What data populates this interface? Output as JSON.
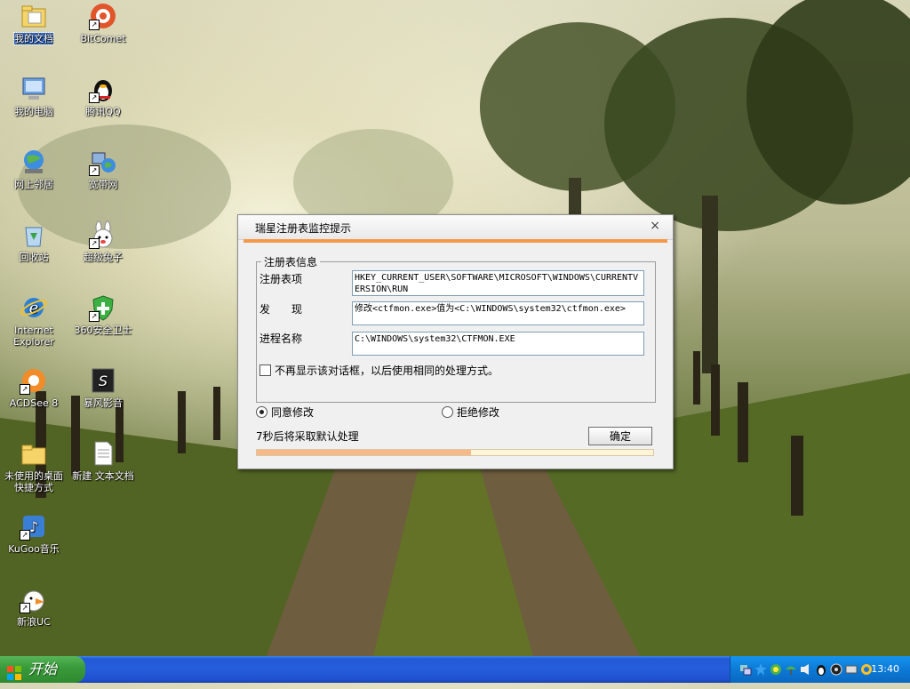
{
  "desktop": {
    "icons": [
      {
        "label": "我的文档"
      },
      {
        "label": "BitComet"
      },
      {
        "label": "我的电脑"
      },
      {
        "label": "腾讯QQ"
      },
      {
        "label": "网上邻居"
      },
      {
        "label": "宽带网"
      },
      {
        "label": "回收站"
      },
      {
        "label": "超级兔子"
      },
      {
        "label": "Internet Explorer"
      },
      {
        "label": "360安全卫士"
      },
      {
        "label": "ACDSee 8"
      },
      {
        "label": "暴风影音"
      },
      {
        "label": "未使用的桌面快捷方式"
      },
      {
        "label": "新建 文本文档"
      },
      {
        "label": "KuGoo音乐"
      },
      {
        "label": "新浪UC"
      }
    ]
  },
  "dialog": {
    "title": "瑞星注册表监控提示",
    "close_glyph": "×",
    "group_title": "注册表信息",
    "registry_label": "注册表项",
    "registry_value": "HKEY_CURRENT_USER\\SOFTWARE\\MICROSOFT\\WINDOWS\\CURRENTVERSION\\RUN",
    "found_label": "发　　现",
    "found_value": "修改<ctfmon.exe>值为<C:\\WINDOWS\\system32\\ctfmon.exe>",
    "process_label": "进程名称",
    "process_value": "C:\\WINDOWS\\system32\\CTFMON.EXE",
    "checkbox_label": "不再显示该对话框，以后使用相同的处理方式。",
    "radio_agree": "同意修改",
    "radio_reject": "拒绝修改",
    "countdown_text": "7秒后将采取默认处理",
    "ok_label": "确定",
    "progress_fraction": 0.54,
    "accent_color": "#f39a4a"
  },
  "taskbar": {
    "start_label": "开始",
    "clock": "13:40"
  }
}
